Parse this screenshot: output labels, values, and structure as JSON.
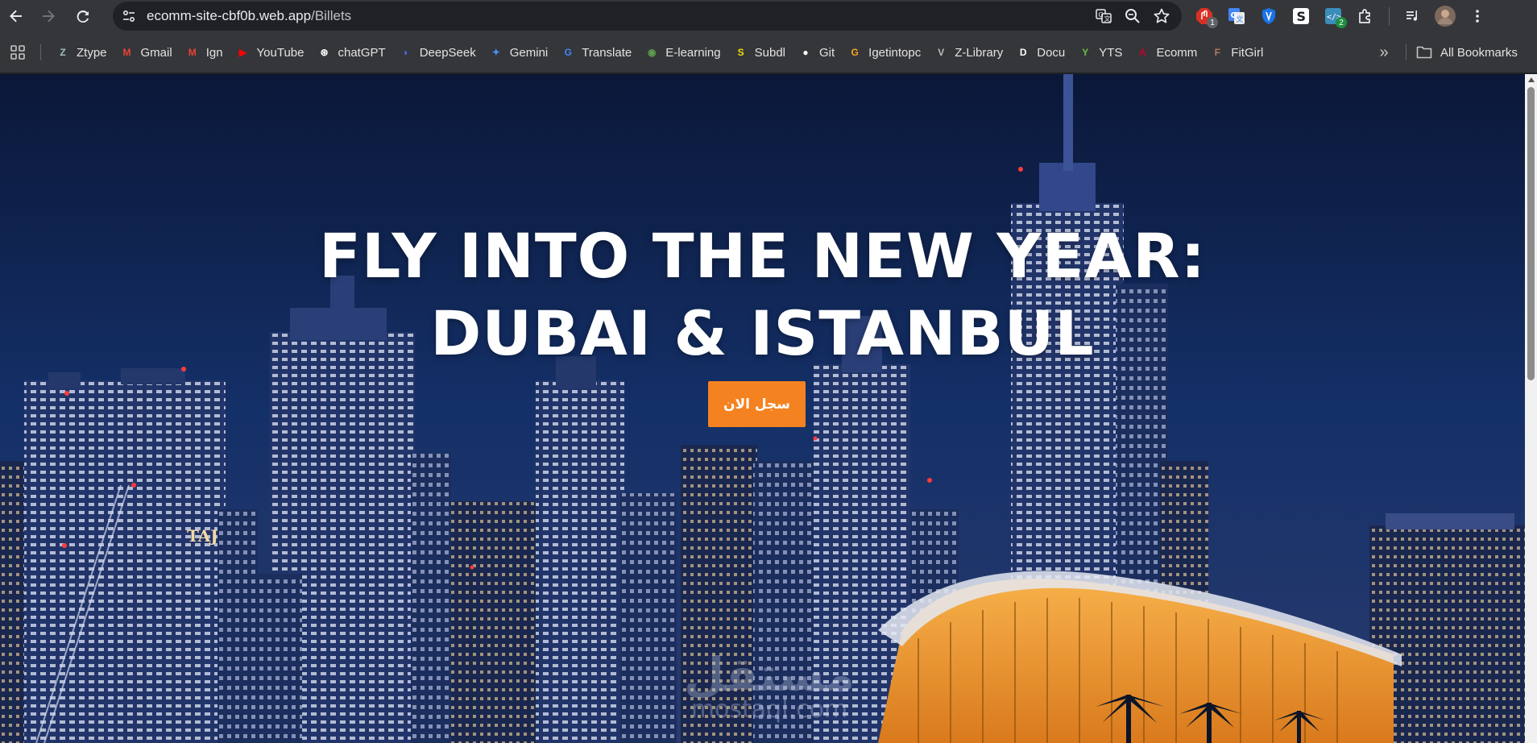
{
  "browser": {
    "url_host": "ecomm-site-cbf0b.web.app",
    "url_path": "/Billets",
    "extensions": [
      {
        "name": "adblock-icon",
        "badge": "1",
        "color": "#d93025"
      },
      {
        "name": "google-translate-extension-icon",
        "badge": "",
        "color": "#4285f4"
      },
      {
        "name": "vpn-shield-icon",
        "badge": "",
        "color": "#1a73e8"
      },
      {
        "name": "s-extension-icon",
        "badge": "",
        "color": "#ffffff"
      },
      {
        "name": "code-extension-icon",
        "badge": "2",
        "color": "#3c8dbc"
      }
    ]
  },
  "bookmarks": {
    "items": [
      {
        "label": "Ztype",
        "icon": "ztype-icon",
        "color": "#9cc3b9",
        "glyph": "Z"
      },
      {
        "label": "Gmail",
        "icon": "gmail-icon",
        "color": "#ea4335",
        "glyph": "M"
      },
      {
        "label": "Ign",
        "icon": "gmail-icon",
        "color": "#ea4335",
        "glyph": "M"
      },
      {
        "label": "YouTube",
        "icon": "youtube-icon",
        "color": "#ff0000",
        "glyph": "▶"
      },
      {
        "label": "chatGPT",
        "icon": "chatgpt-icon",
        "color": "#ffffff",
        "glyph": "⊛"
      },
      {
        "label": "DeepSeek",
        "icon": "deepseek-icon",
        "color": "#4d6bfe",
        "glyph": "◗"
      },
      {
        "label": "Gemini",
        "icon": "gemini-icon",
        "color": "#4f8df5",
        "glyph": "✦"
      },
      {
        "label": "Translate",
        "icon": "google-translate-icon",
        "color": "#4285f4",
        "glyph": "G"
      },
      {
        "label": "E-learning",
        "icon": "elearning-icon",
        "color": "#5f9f4f",
        "glyph": "◉"
      },
      {
        "label": "Subdl",
        "icon": "subdl-icon",
        "color": "#f5d90a",
        "glyph": "S"
      },
      {
        "label": "Git",
        "icon": "github-icon",
        "color": "#ffffff",
        "glyph": "●"
      },
      {
        "label": "Igetintopc",
        "icon": "igetintopc-icon",
        "color": "#f5a623",
        "glyph": "G"
      },
      {
        "label": "Z-Library",
        "icon": "zlibrary-icon",
        "color": "#bdbdbd",
        "glyph": "V"
      },
      {
        "label": "Docu",
        "icon": "docu-icon",
        "color": "#ffffff",
        "glyph": "D"
      },
      {
        "label": "YTS",
        "icon": "yts-icon",
        "color": "#6ac045",
        "glyph": "Y"
      },
      {
        "label": "Ecomm",
        "icon": "angular-icon",
        "color": "#c3002f",
        "glyph": "A"
      },
      {
        "label": "FitGirl",
        "icon": "fitgirl-icon",
        "color": "#b07a5a",
        "glyph": "F"
      }
    ],
    "all_label": "All Bookmarks"
  },
  "hero": {
    "title_line1": "FLY INTO THE NEW YEAR:",
    "title_line2": "DUBAI & ISTANBUL",
    "cta_label": "سجل الان",
    "cta_color": "#f58220",
    "watermark_ar": "مستقل",
    "watermark_latin": "mostaql.com"
  }
}
